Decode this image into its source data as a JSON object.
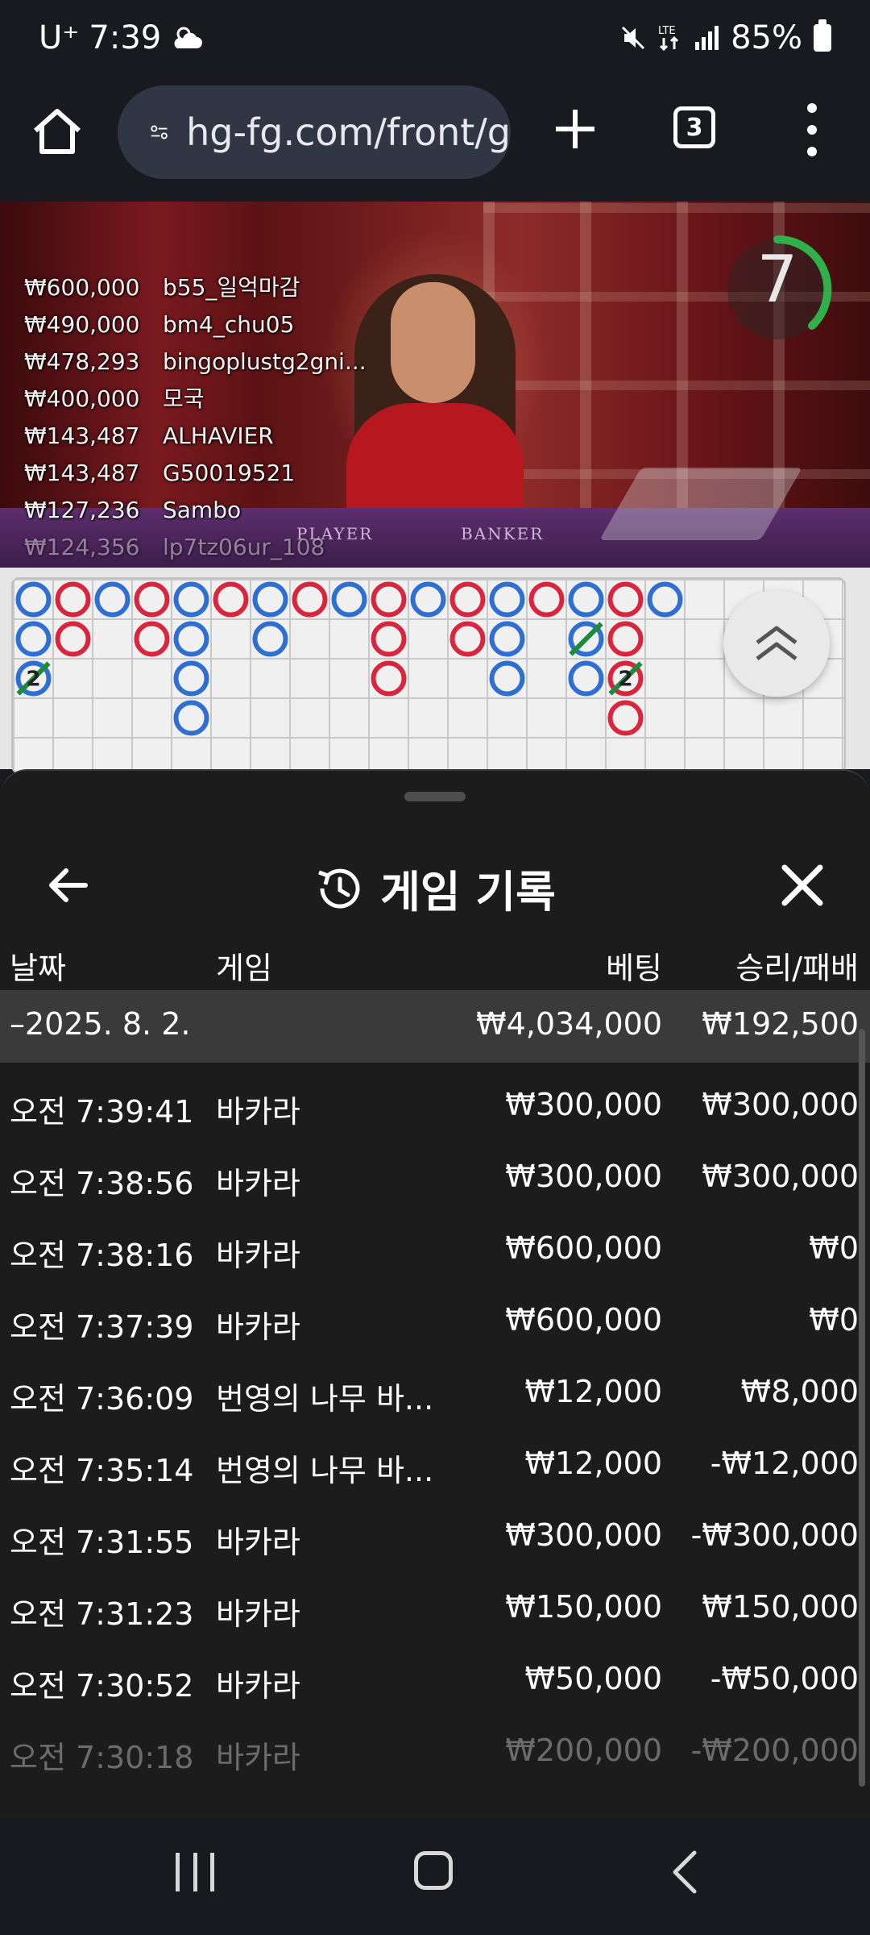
{
  "status_bar": {
    "carrier": "U⁺",
    "time": "7:39",
    "weather_icon": "cloud-sun-icon",
    "icons": [
      "mute-icon",
      "lte-icon",
      "signal-icon"
    ],
    "battery": "85%"
  },
  "browser": {
    "url": "hg-fg.com/front/g",
    "tab_count": "3"
  },
  "video": {
    "timer": "7",
    "table_labels": [
      "PLAYER",
      "BANKER"
    ],
    "bets": [
      {
        "amount": "₩600,000",
        "user": "b55_일억마감"
      },
      {
        "amount": "₩490,000",
        "user": "bm4_chu05"
      },
      {
        "amount": "₩478,293",
        "user": "bingoplustg2gni..."
      },
      {
        "amount": "₩400,000",
        "user": "모국"
      },
      {
        "amount": "₩143,487",
        "user": "ALHAVIER"
      },
      {
        "amount": "₩143,487",
        "user": "G50019521"
      },
      {
        "amount": "₩127,236",
        "user": "Sambo"
      },
      {
        "amount": "₩124,356",
        "user": "lp7tz06ur_108"
      }
    ]
  },
  "roadmap": {
    "colors": {
      "player": "#2e6fd1",
      "banker": "#d7263d",
      "tie": "#1e8a3c"
    },
    "tie_count_label": "2",
    "columns": [
      [
        "B",
        "B",
        "B2"
      ],
      [
        "R",
        "R"
      ],
      [
        "B"
      ],
      [
        "R",
        "R"
      ],
      [
        "B",
        "B",
        "B",
        "B"
      ],
      [
        "R"
      ],
      [
        "B",
        "B"
      ],
      [
        "R"
      ],
      [
        "B"
      ],
      [
        "R",
        "R",
        "R"
      ],
      [
        "B"
      ],
      [
        "R",
        "R"
      ],
      [
        "B",
        "B",
        "B"
      ],
      [
        "R"
      ],
      [
        "B",
        "BT",
        "B"
      ],
      [
        "R",
        "R",
        "R2",
        "R"
      ],
      [
        "B"
      ]
    ]
  },
  "sheet": {
    "title": "게임 기록",
    "headers": {
      "date": "날짜",
      "game": "게임",
      "bet": "베팅",
      "result": "승리/패배"
    },
    "summary": {
      "date": "–2025. 8. 2.",
      "bet": "₩4,034,000",
      "result": "₩192,500"
    },
    "rows": [
      {
        "time": "오전 7:39:41",
        "game": "바카라",
        "bet": "₩300,000",
        "result": "₩300,000"
      },
      {
        "time": "오전 7:38:56",
        "game": "바카라",
        "bet": "₩300,000",
        "result": "₩300,000"
      },
      {
        "time": "오전 7:38:16",
        "game": "바카라",
        "bet": "₩600,000",
        "result": "₩0"
      },
      {
        "time": "오전 7:37:39",
        "game": "바카라",
        "bet": "₩600,000",
        "result": "₩0"
      },
      {
        "time": "오전 7:36:09",
        "game": "번영의 나무 바...",
        "bet": "₩12,000",
        "result": "₩8,000"
      },
      {
        "time": "오전 7:35:14",
        "game": "번영의 나무 바...",
        "bet": "₩12,000",
        "result": "-₩12,000"
      },
      {
        "time": "오전 7:31:55",
        "game": "바카라",
        "bet": "₩300,000",
        "result": "-₩300,000"
      },
      {
        "time": "오전 7:31:23",
        "game": "바카라",
        "bet": "₩150,000",
        "result": "₩150,000"
      },
      {
        "time": "오전 7:30:52",
        "game": "바카라",
        "bet": "₩50,000",
        "result": "-₩50,000"
      },
      {
        "time": "오전 7:30:18",
        "game": "바카라",
        "bet": "₩200,000",
        "result": "-₩200,000"
      }
    ]
  }
}
